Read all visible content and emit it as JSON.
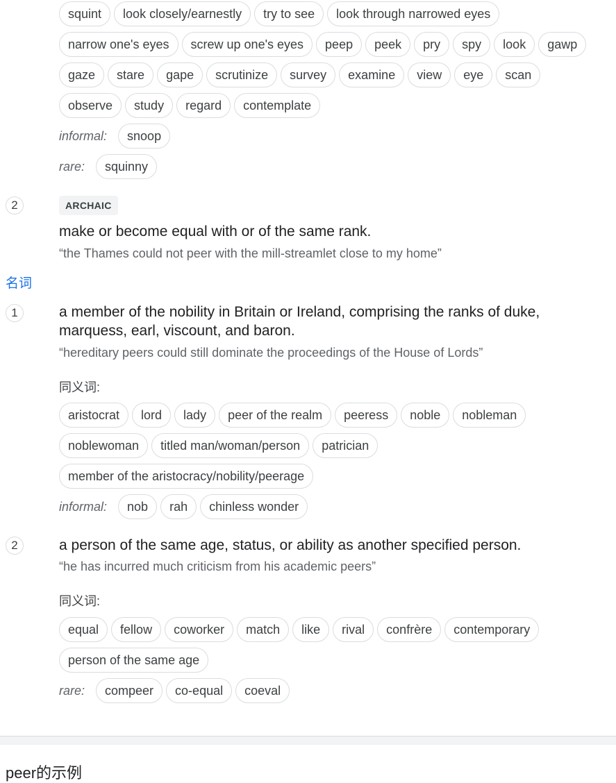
{
  "verb_sense1": {
    "rows": [
      [
        "squint",
        "look closely/earnestly",
        "try to see",
        "look through narrowed eyes"
      ],
      [
        "narrow one's eyes",
        "screw up one's eyes",
        "peep",
        "peek",
        "pry",
        "spy",
        "look",
        "gawp"
      ],
      [
        "gaze",
        "stare",
        "gape",
        "scrutinize",
        "survey",
        "examine",
        "view",
        "eye",
        "scan"
      ],
      [
        "observe",
        "study",
        "regard",
        "contemplate"
      ]
    ],
    "informal_label": "informal:",
    "informal": [
      "snoop"
    ],
    "rare_label": "rare:",
    "rare": [
      "squinny"
    ]
  },
  "verb_sense2": {
    "number": "2",
    "badge": "ARCHAIC",
    "definition": "make or become equal with or of the same rank.",
    "example": "“the Thames could not peer with the mill-streamlet close to my home”"
  },
  "noun": {
    "pos_label": "名词",
    "sense1": {
      "number": "1",
      "definition": "a member of the nobility in Britain or Ireland, comprising the ranks of duke, marquess, earl, viscount, and baron.",
      "example": "“hereditary peers could still dominate the proceedings of the House of Lords”",
      "synonyms_label": "同义词:",
      "rows": [
        [
          "aristocrat",
          "lord",
          "lady",
          "peer of the realm",
          "peeress",
          "noble",
          "nobleman"
        ],
        [
          "noblewoman",
          "titled man/woman/person",
          "patrician"
        ],
        [
          "member of the aristocracy/nobility/peerage"
        ]
      ],
      "informal_label": "informal:",
      "informal": [
        "nob",
        "rah",
        "chinless wonder"
      ]
    },
    "sense2": {
      "number": "2",
      "definition": "a person of the same age, status, or ability as another specified person.",
      "example": "“he has incurred much criticism from his academic peers”",
      "synonyms_label": "同义词:",
      "rows": [
        [
          "equal",
          "fellow",
          "coworker",
          "match",
          "like",
          "rival",
          "confrère",
          "contemporary"
        ],
        [
          "person of the same age"
        ]
      ],
      "rare_label": "rare:",
      "rare": [
        "compeer",
        "co-equal",
        "coeval"
      ]
    }
  },
  "examples_title": "peer的示例"
}
